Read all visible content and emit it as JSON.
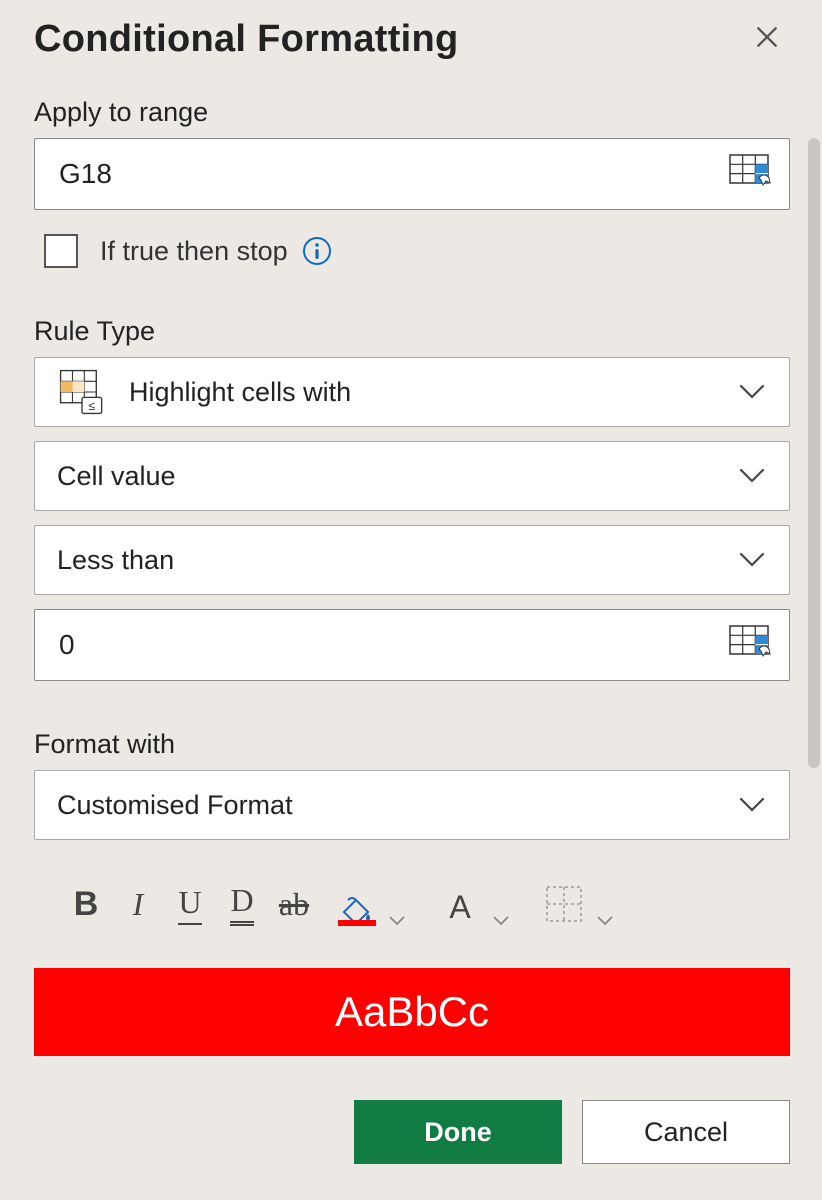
{
  "header": {
    "title": "Conditional Formatting"
  },
  "range": {
    "label": "Apply to range",
    "value": "G18",
    "checkbox_label": "If true then stop"
  },
  "rule": {
    "label": "Rule Type",
    "type": "Highlight cells with",
    "field": "Cell value",
    "operator": "Less than",
    "value": "0"
  },
  "format": {
    "label": "Format with",
    "style": "Customised Format",
    "preview_text": "AaBbCc",
    "fill_color": "#fe0000",
    "font_color": "#ffffff"
  },
  "toolbar": {
    "bold": "B",
    "italic": "I",
    "underline": "U",
    "double_underline": "D",
    "strike": "ab",
    "font_color_letter": "A"
  },
  "buttons": {
    "done": "Done",
    "cancel": "Cancel"
  }
}
